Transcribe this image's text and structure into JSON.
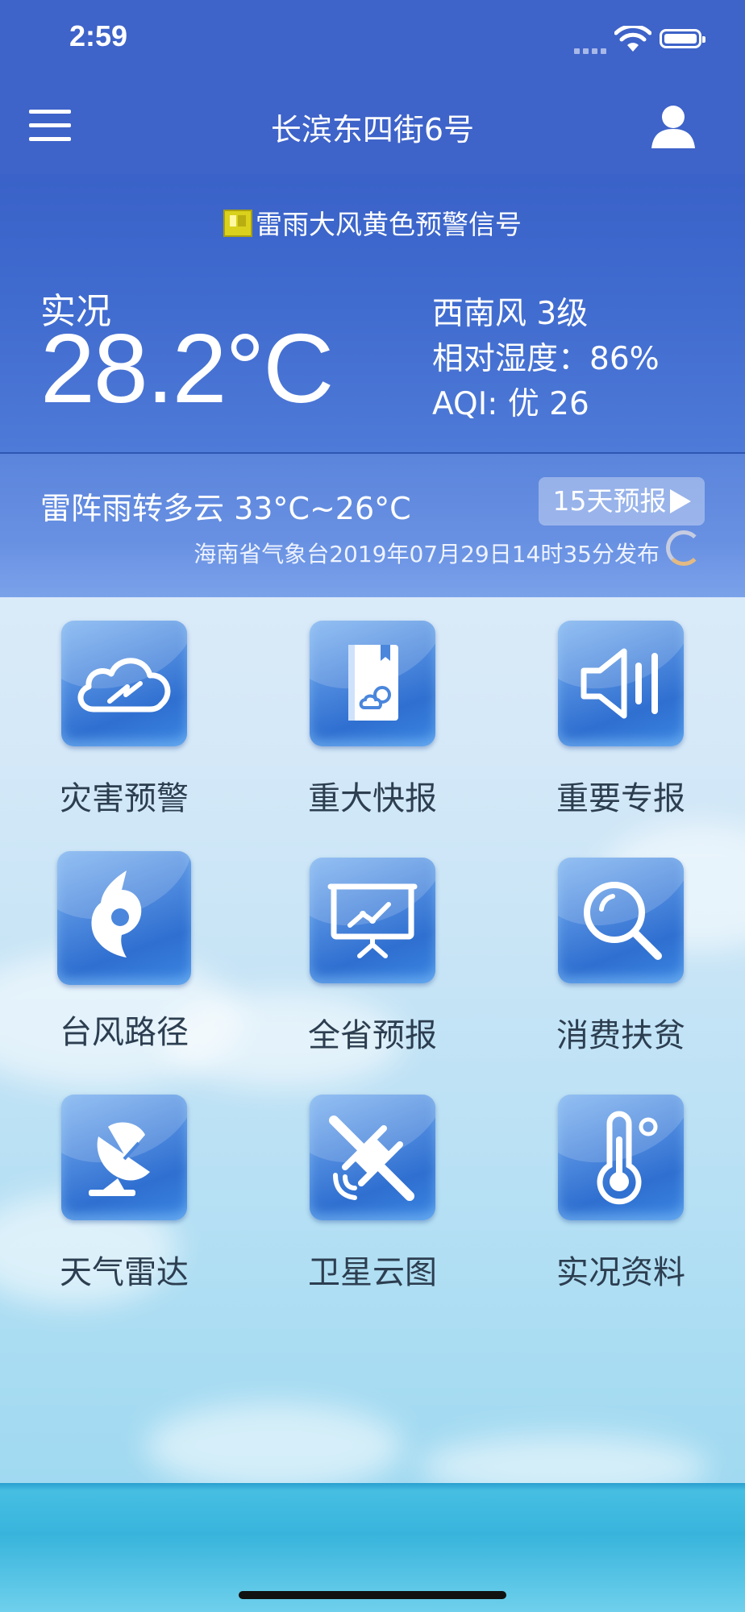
{
  "status_bar": {
    "time": "2:59"
  },
  "nav": {
    "title": "长滨东四街6号"
  },
  "warning": {
    "text": "雷雨大风黄色预警信号"
  },
  "current": {
    "label": "实况",
    "temperature": "28.2°C",
    "wind": "西南风  3级",
    "humidity": "相对湿度：86%",
    "aqi": "AQI: 优 26"
  },
  "forecast": {
    "summary": "雷阵雨转多云  33°C~26°C",
    "button_label": "15天预报",
    "publish_info": "海南省气象台2019年07月29日14时35分发布"
  },
  "menu": [
    {
      "label": "灾害预警",
      "icon": "cloud-lightning-icon"
    },
    {
      "label": "重大快报",
      "icon": "book-weather-icon"
    },
    {
      "label": "重要专报",
      "icon": "speaker-icon"
    },
    {
      "label": "台风路径",
      "icon": "typhoon-icon"
    },
    {
      "label": "全省预报",
      "icon": "presentation-chart-icon"
    },
    {
      "label": "消费扶贫",
      "icon": "search-icon"
    },
    {
      "label": "天气雷达",
      "icon": "radar-dish-icon"
    },
    {
      "label": "卫星云图",
      "icon": "satellite-icon"
    },
    {
      "label": "实况资料",
      "icon": "thermometer-icon"
    }
  ]
}
